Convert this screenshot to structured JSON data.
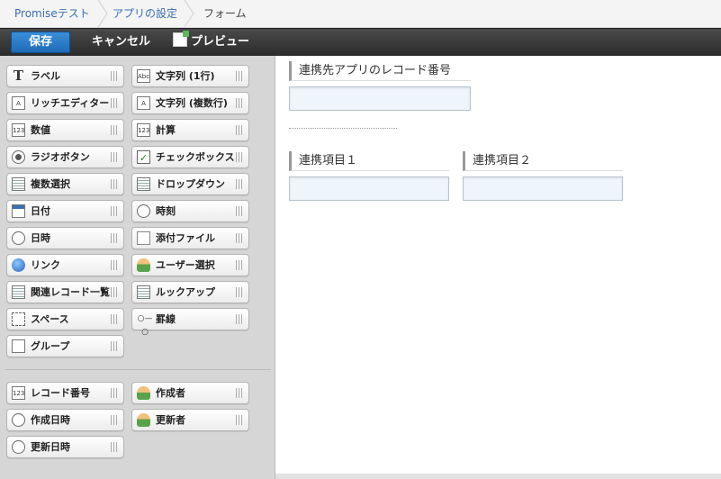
{
  "breadcrumb": {
    "items": [
      "Promiseテスト",
      "アプリの設定",
      "フォーム"
    ]
  },
  "toolbar": {
    "save_label": "保存",
    "cancel_label": "キャンセル",
    "preview_label": "プレビュー"
  },
  "palette": {
    "items": [
      {
        "label": "ラベル",
        "icon": "text-label-icon"
      },
      {
        "label": "文字列 (1行)",
        "icon": "single-line-text-icon"
      },
      {
        "label": "リッチエディター",
        "icon": "rich-editor-icon"
      },
      {
        "label": "文字列 (複数行)",
        "icon": "multi-line-text-icon"
      },
      {
        "label": "数値",
        "icon": "number-icon"
      },
      {
        "label": "計算",
        "icon": "calc-icon"
      },
      {
        "label": "ラジオボタン",
        "icon": "radio-icon"
      },
      {
        "label": "チェックボックス",
        "icon": "checkbox-icon"
      },
      {
        "label": "複数選択",
        "icon": "multi-select-icon"
      },
      {
        "label": "ドロップダウン",
        "icon": "dropdown-icon"
      },
      {
        "label": "日付",
        "icon": "calendar-icon"
      },
      {
        "label": "時刻",
        "icon": "clock-icon"
      },
      {
        "label": "日時",
        "icon": "datetime-icon"
      },
      {
        "label": "添付ファイル",
        "icon": "attachment-icon"
      },
      {
        "label": "リンク",
        "icon": "link-globe-icon"
      },
      {
        "label": "ユーザー選択",
        "icon": "user-select-icon"
      },
      {
        "label": "関連レコード一覧",
        "icon": "related-records-icon"
      },
      {
        "label": "ルックアップ",
        "icon": "lookup-icon"
      },
      {
        "label": "スペース",
        "icon": "space-icon"
      },
      {
        "label": "罫線",
        "icon": "border-line-icon"
      },
      {
        "label": "グループ",
        "icon": "group-icon"
      }
    ],
    "system_items": [
      {
        "label": "レコード番号",
        "icon": "record-number-icon"
      },
      {
        "label": "作成者",
        "icon": "creator-icon"
      },
      {
        "label": "作成日時",
        "icon": "created-datetime-icon"
      },
      {
        "label": "更新者",
        "icon": "updater-icon"
      },
      {
        "label": "更新日時",
        "icon": "updated-datetime-icon"
      }
    ]
  },
  "canvas": {
    "lookup_field_label": "連携先アプリのレコード番号",
    "field1_label": "連携項目１",
    "field2_label": "連携項目２"
  }
}
